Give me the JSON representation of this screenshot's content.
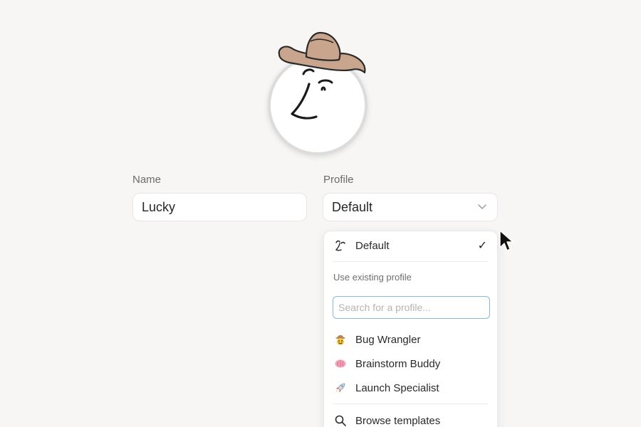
{
  "form": {
    "name_label": "Name",
    "name_value": "Lucky",
    "profile_label": "Profile",
    "profile_value": "Default"
  },
  "dropdown": {
    "selected": {
      "label": "Default",
      "icon": "squiggle-face-icon",
      "check": "✓"
    },
    "section_label": "Use existing profile",
    "search_placeholder": "Search for a profile...",
    "profiles": [
      {
        "label": "Bug Wrangler",
        "icon": "cowboy-face-icon",
        "emoji": "🤠"
      },
      {
        "label": "Brainstorm Buddy",
        "icon": "brain-icon",
        "emoji": "🧠"
      },
      {
        "label": "Launch Specialist",
        "icon": "rocket-icon",
        "emoji": "🚀"
      }
    ],
    "browse_label": "Browse templates"
  },
  "colors": {
    "background": "#f7f6f4",
    "search_focus_border": "#86b7e0",
    "hat": "#c9a58d"
  }
}
